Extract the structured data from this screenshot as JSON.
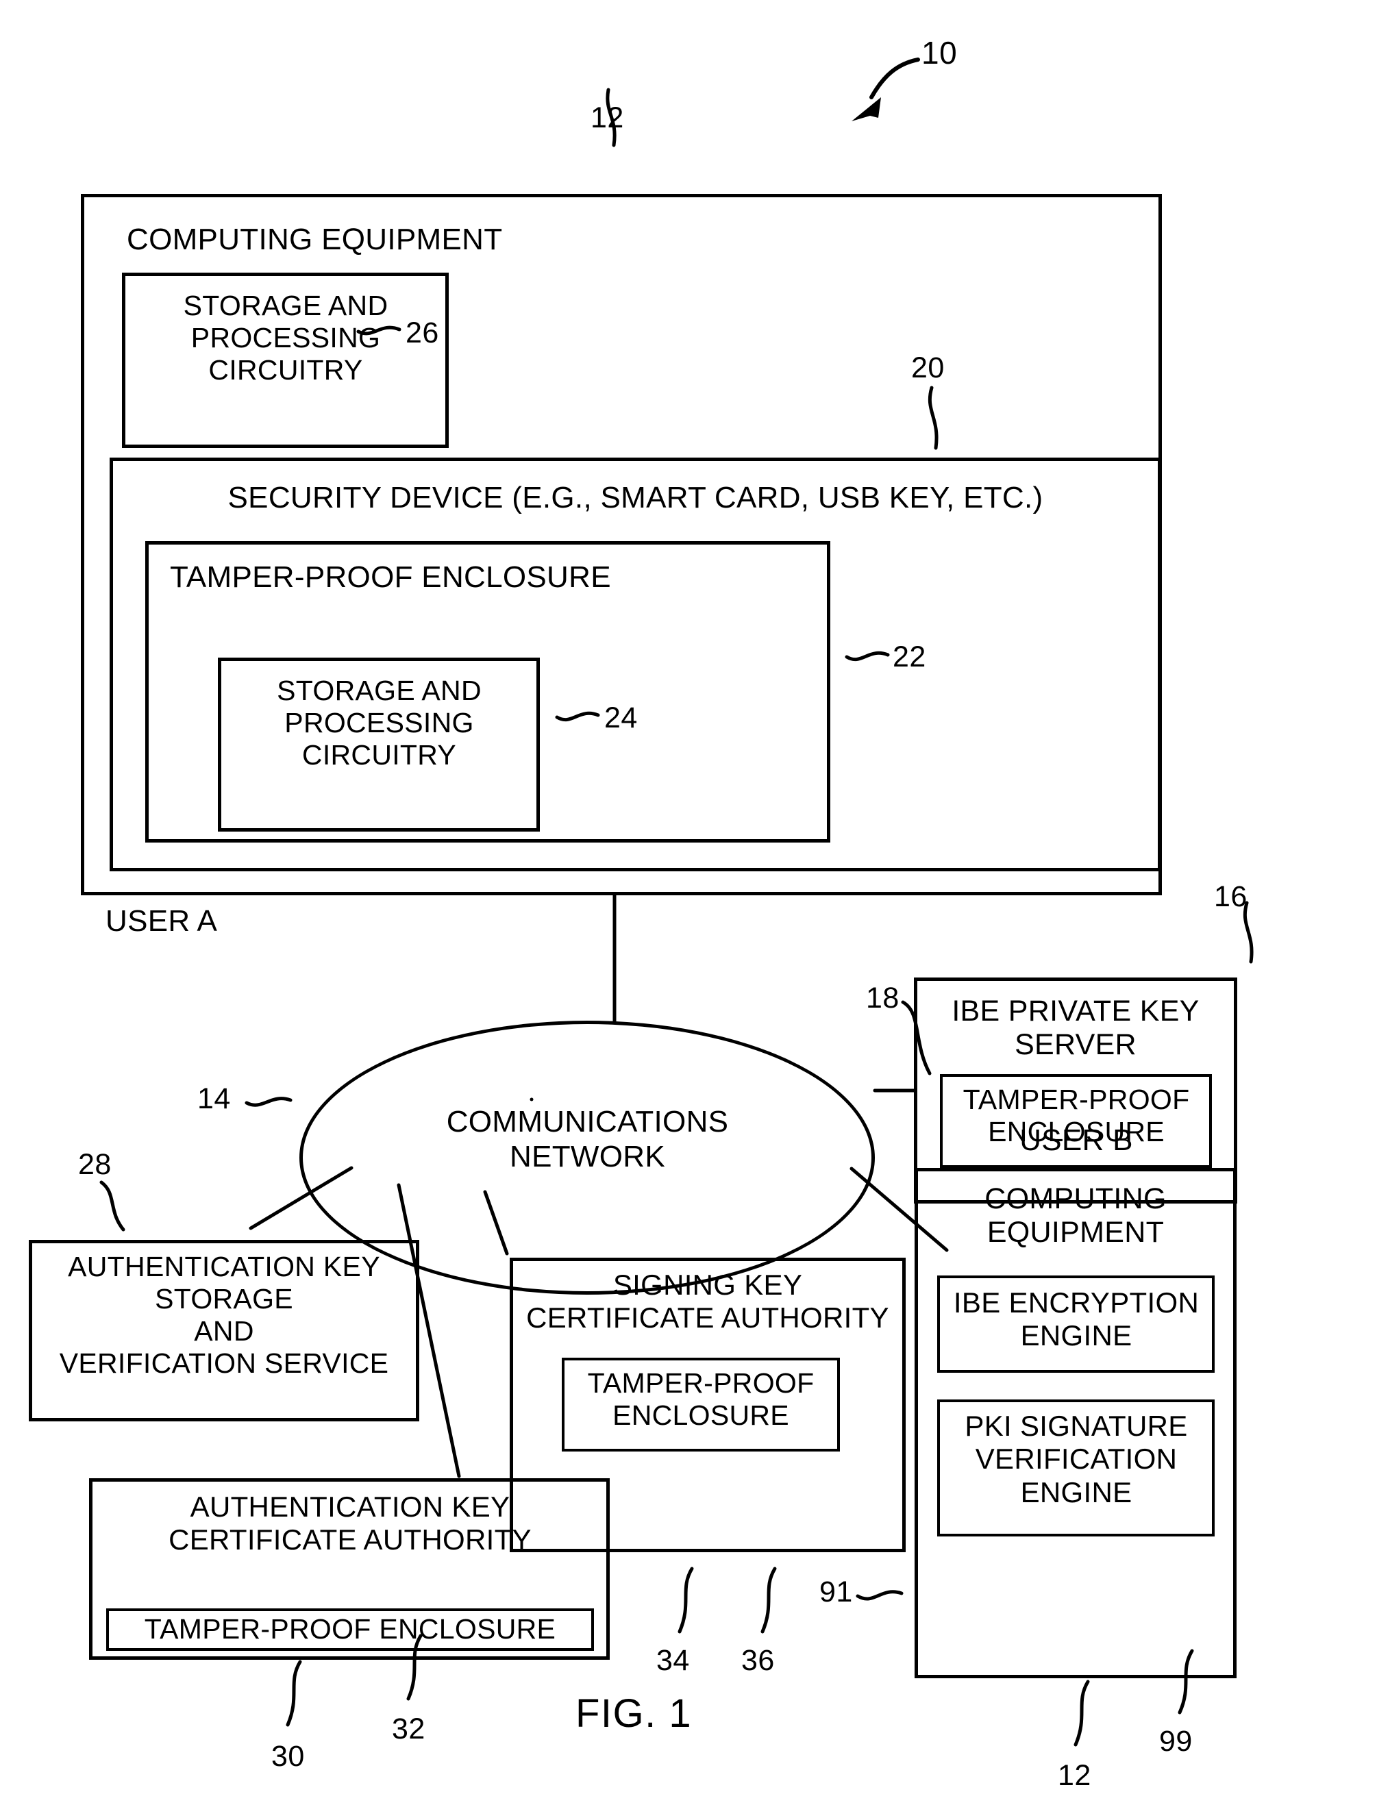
{
  "figure": {
    "caption": "FIG. 1",
    "system_ref": "10"
  },
  "user_a": {
    "label": "USER A",
    "computing_equipment": {
      "title": "COMPUTING EQUIPMENT",
      "ref": "12",
      "storage_processing": {
        "title": "STORAGE AND\nPROCESSING\nCIRCUITRY",
        "ref": "26"
      },
      "security_device": {
        "title": "SECURITY DEVICE (E.G., SMART CARD, USB KEY, ETC.)",
        "ref": "20",
        "tamper_proof_enclosure": {
          "title": "TAMPER-PROOF ENCLOSURE",
          "ref": "22",
          "storage_processing": {
            "title": "STORAGE AND\nPROCESSING\nCIRCUITRY",
            "ref": "24"
          }
        }
      }
    }
  },
  "network": {
    "title": "COMMUNICATIONS\nNETWORK",
    "ref": "14"
  },
  "ibe_private_key_server": {
    "title": "IBE PRIVATE KEY\nSERVER",
    "ref": "16",
    "tamper_proof_enclosure": {
      "title": "TAMPER-PROOF\nENCLOSURE",
      "ref": "18"
    }
  },
  "auth_key_storage_service": {
    "title": "AUTHENTICATION KEY\nSTORAGE\nAND\nVERIFICATION SERVICE",
    "ref": "28"
  },
  "auth_key_certificate_authority": {
    "title": "AUTHENTICATION KEY\nCERTIFICATE AUTHORITY",
    "ref": "30",
    "tamper_proof_enclosure": {
      "title": "TAMPER-PROOF ENCLOSURE",
      "ref": "32"
    }
  },
  "signing_key_certificate_authority": {
    "title": "SIGNING KEY\nCERTIFICATE AUTHORITY",
    "ref": "34",
    "tamper_proof_enclosure": {
      "title": "TAMPER-PROOF\nENCLOSURE",
      "ref": "36"
    }
  },
  "user_b": {
    "label": "USER B",
    "computing_equipment": {
      "title": "COMPUTING\nEQUIPMENT",
      "ref": "12",
      "ibe_encryption_engine": {
        "title": "IBE ENCRYPTION\nENGINE",
        "ref": "91"
      },
      "pki_signature_verification_engine": {
        "title": "PKI SIGNATURE\nVERIFICATION\nENGINE",
        "ref": "99"
      }
    }
  },
  "colors": {
    "ink": "#000000",
    "paper": "#ffffff"
  }
}
